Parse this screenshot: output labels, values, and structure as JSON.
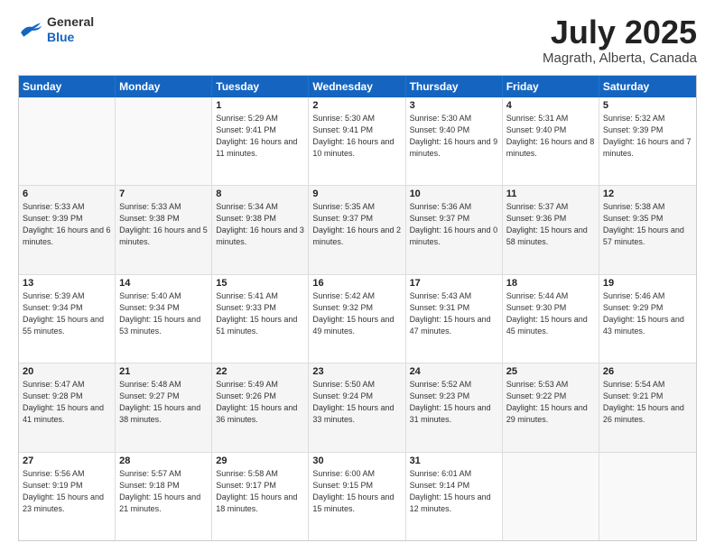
{
  "header": {
    "logo": {
      "line1": "General",
      "line2": "Blue"
    },
    "title": "July 2025",
    "location": "Magrath, Alberta, Canada"
  },
  "calendar": {
    "days_of_week": [
      "Sunday",
      "Monday",
      "Tuesday",
      "Wednesday",
      "Thursday",
      "Friday",
      "Saturday"
    ],
    "weeks": [
      [
        {
          "day": "",
          "sunrise": "",
          "sunset": "",
          "daylight": ""
        },
        {
          "day": "",
          "sunrise": "",
          "sunset": "",
          "daylight": ""
        },
        {
          "day": "1",
          "sunrise": "Sunrise: 5:29 AM",
          "sunset": "Sunset: 9:41 PM",
          "daylight": "Daylight: 16 hours and 11 minutes."
        },
        {
          "day": "2",
          "sunrise": "Sunrise: 5:30 AM",
          "sunset": "Sunset: 9:41 PM",
          "daylight": "Daylight: 16 hours and 10 minutes."
        },
        {
          "day": "3",
          "sunrise": "Sunrise: 5:30 AM",
          "sunset": "Sunset: 9:40 PM",
          "daylight": "Daylight: 16 hours and 9 minutes."
        },
        {
          "day": "4",
          "sunrise": "Sunrise: 5:31 AM",
          "sunset": "Sunset: 9:40 PM",
          "daylight": "Daylight: 16 hours and 8 minutes."
        },
        {
          "day": "5",
          "sunrise": "Sunrise: 5:32 AM",
          "sunset": "Sunset: 9:39 PM",
          "daylight": "Daylight: 16 hours and 7 minutes."
        }
      ],
      [
        {
          "day": "6",
          "sunrise": "Sunrise: 5:33 AM",
          "sunset": "Sunset: 9:39 PM",
          "daylight": "Daylight: 16 hours and 6 minutes."
        },
        {
          "day": "7",
          "sunrise": "Sunrise: 5:33 AM",
          "sunset": "Sunset: 9:38 PM",
          "daylight": "Daylight: 16 hours and 5 minutes."
        },
        {
          "day": "8",
          "sunrise": "Sunrise: 5:34 AM",
          "sunset": "Sunset: 9:38 PM",
          "daylight": "Daylight: 16 hours and 3 minutes."
        },
        {
          "day": "9",
          "sunrise": "Sunrise: 5:35 AM",
          "sunset": "Sunset: 9:37 PM",
          "daylight": "Daylight: 16 hours and 2 minutes."
        },
        {
          "day": "10",
          "sunrise": "Sunrise: 5:36 AM",
          "sunset": "Sunset: 9:37 PM",
          "daylight": "Daylight: 16 hours and 0 minutes."
        },
        {
          "day": "11",
          "sunrise": "Sunrise: 5:37 AM",
          "sunset": "Sunset: 9:36 PM",
          "daylight": "Daylight: 15 hours and 58 minutes."
        },
        {
          "day": "12",
          "sunrise": "Sunrise: 5:38 AM",
          "sunset": "Sunset: 9:35 PM",
          "daylight": "Daylight: 15 hours and 57 minutes."
        }
      ],
      [
        {
          "day": "13",
          "sunrise": "Sunrise: 5:39 AM",
          "sunset": "Sunset: 9:34 PM",
          "daylight": "Daylight: 15 hours and 55 minutes."
        },
        {
          "day": "14",
          "sunrise": "Sunrise: 5:40 AM",
          "sunset": "Sunset: 9:34 PM",
          "daylight": "Daylight: 15 hours and 53 minutes."
        },
        {
          "day": "15",
          "sunrise": "Sunrise: 5:41 AM",
          "sunset": "Sunset: 9:33 PM",
          "daylight": "Daylight: 15 hours and 51 minutes."
        },
        {
          "day": "16",
          "sunrise": "Sunrise: 5:42 AM",
          "sunset": "Sunset: 9:32 PM",
          "daylight": "Daylight: 15 hours and 49 minutes."
        },
        {
          "day": "17",
          "sunrise": "Sunrise: 5:43 AM",
          "sunset": "Sunset: 9:31 PM",
          "daylight": "Daylight: 15 hours and 47 minutes."
        },
        {
          "day": "18",
          "sunrise": "Sunrise: 5:44 AM",
          "sunset": "Sunset: 9:30 PM",
          "daylight": "Daylight: 15 hours and 45 minutes."
        },
        {
          "day": "19",
          "sunrise": "Sunrise: 5:46 AM",
          "sunset": "Sunset: 9:29 PM",
          "daylight": "Daylight: 15 hours and 43 minutes."
        }
      ],
      [
        {
          "day": "20",
          "sunrise": "Sunrise: 5:47 AM",
          "sunset": "Sunset: 9:28 PM",
          "daylight": "Daylight: 15 hours and 41 minutes."
        },
        {
          "day": "21",
          "sunrise": "Sunrise: 5:48 AM",
          "sunset": "Sunset: 9:27 PM",
          "daylight": "Daylight: 15 hours and 38 minutes."
        },
        {
          "day": "22",
          "sunrise": "Sunrise: 5:49 AM",
          "sunset": "Sunset: 9:26 PM",
          "daylight": "Daylight: 15 hours and 36 minutes."
        },
        {
          "day": "23",
          "sunrise": "Sunrise: 5:50 AM",
          "sunset": "Sunset: 9:24 PM",
          "daylight": "Daylight: 15 hours and 33 minutes."
        },
        {
          "day": "24",
          "sunrise": "Sunrise: 5:52 AM",
          "sunset": "Sunset: 9:23 PM",
          "daylight": "Daylight: 15 hours and 31 minutes."
        },
        {
          "day": "25",
          "sunrise": "Sunrise: 5:53 AM",
          "sunset": "Sunset: 9:22 PM",
          "daylight": "Daylight: 15 hours and 29 minutes."
        },
        {
          "day": "26",
          "sunrise": "Sunrise: 5:54 AM",
          "sunset": "Sunset: 9:21 PM",
          "daylight": "Daylight: 15 hours and 26 minutes."
        }
      ],
      [
        {
          "day": "27",
          "sunrise": "Sunrise: 5:56 AM",
          "sunset": "Sunset: 9:19 PM",
          "daylight": "Daylight: 15 hours and 23 minutes."
        },
        {
          "day": "28",
          "sunrise": "Sunrise: 5:57 AM",
          "sunset": "Sunset: 9:18 PM",
          "daylight": "Daylight: 15 hours and 21 minutes."
        },
        {
          "day": "29",
          "sunrise": "Sunrise: 5:58 AM",
          "sunset": "Sunset: 9:17 PM",
          "daylight": "Daylight: 15 hours and 18 minutes."
        },
        {
          "day": "30",
          "sunrise": "Sunrise: 6:00 AM",
          "sunset": "Sunset: 9:15 PM",
          "daylight": "Daylight: 15 hours and 15 minutes."
        },
        {
          "day": "31",
          "sunrise": "Sunrise: 6:01 AM",
          "sunset": "Sunset: 9:14 PM",
          "daylight": "Daylight: 15 hours and 12 minutes."
        },
        {
          "day": "",
          "sunrise": "",
          "sunset": "",
          "daylight": ""
        },
        {
          "day": "",
          "sunrise": "",
          "sunset": "",
          "daylight": ""
        }
      ]
    ]
  }
}
